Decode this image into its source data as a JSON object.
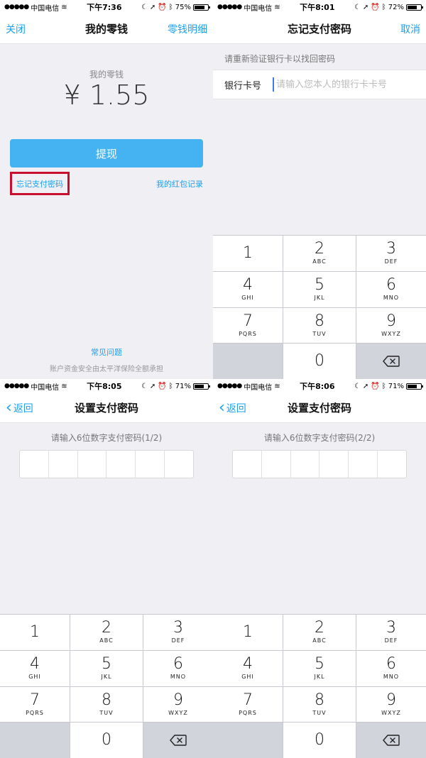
{
  "panel1": {
    "status": {
      "carrier": "中国电信",
      "time": "下午7:36",
      "battery": "75%",
      "battery_level": 0.75
    },
    "nav": {
      "left": "关闭",
      "title": "我的零钱",
      "right": "零钱明细"
    },
    "balance_label": "我的零钱",
    "balance_value": "¥ 1.55",
    "withdraw_button": "提现",
    "forgot_link": "忘记支付密码",
    "redpacket_link": "我的红包记录",
    "faq_link": "常见问题",
    "safety_text": "账户资金安全由太平洋保险全额承担"
  },
  "panel2": {
    "status": {
      "carrier": "中国电信",
      "time": "下午8:01",
      "battery": "72%",
      "battery_level": 0.72
    },
    "nav": {
      "title": "忘记支付密码",
      "right": "取消"
    },
    "hint": "请重新验证银行卡以找回密码",
    "card_label": "银行卡号",
    "card_placeholder": "请输入您本人的银行卡卡号"
  },
  "panel3": {
    "status": {
      "carrier": "中国电信",
      "time": "下午8:05",
      "battery": "71%",
      "battery_level": 0.71
    },
    "nav": {
      "left": "返回",
      "title": "设置支付密码"
    },
    "hint": "请输入6位数字支付密码(1/2)"
  },
  "panel4": {
    "status": {
      "carrier": "中国电信",
      "time": "下午8:06",
      "battery": "71%",
      "battery_level": 0.71
    },
    "nav": {
      "left": "返回",
      "title": "设置支付密码"
    },
    "hint": "请输入6位数字支付密码(2/2)"
  },
  "keypad": [
    {
      "num": "1",
      "letters": ""
    },
    {
      "num": "2",
      "letters": "ABC"
    },
    {
      "num": "3",
      "letters": "DEF"
    },
    {
      "num": "4",
      "letters": "GHI"
    },
    {
      "num": "5",
      "letters": "JKL"
    },
    {
      "num": "6",
      "letters": "MNO"
    },
    {
      "num": "7",
      "letters": "PQRS"
    },
    {
      "num": "8",
      "letters": "TUV"
    },
    {
      "num": "9",
      "letters": "WXYZ"
    },
    {
      "num": "",
      "letters": ""
    },
    {
      "num": "0",
      "letters": ""
    },
    {
      "num": "",
      "letters": ""
    }
  ],
  "colors": {
    "accent": "#1aa1f1",
    "button": "#45b3f2",
    "highlight": "#c8102e",
    "background": "#efeff4"
  }
}
